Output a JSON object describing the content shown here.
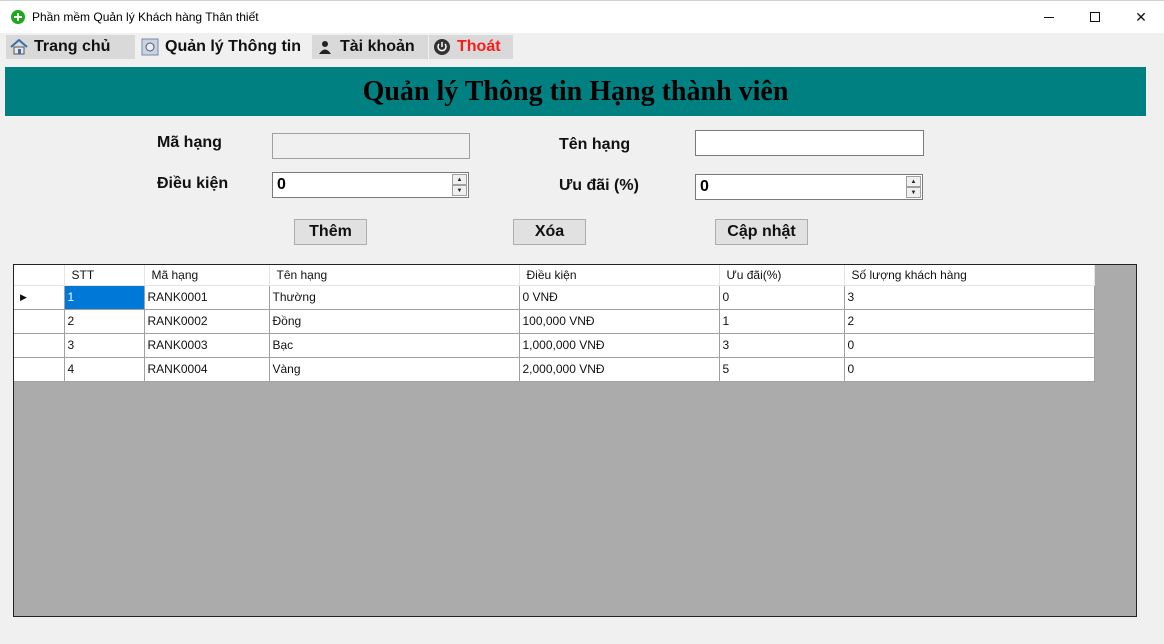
{
  "window": {
    "title": "Phần mềm Quản lý Khách hàng Thân thiết"
  },
  "menu": {
    "home": "Trang chủ",
    "info": "Quản lý Thông tin",
    "account": "Tài khoản",
    "exit": "Thoát"
  },
  "page": {
    "title": "Quản lý Thông tin Hạng thành viên"
  },
  "form": {
    "code_label": "Mã hạng",
    "code_value": "",
    "name_label": "Tên hạng",
    "name_value": "",
    "condition_label": "Điều kiện",
    "condition_value": "0",
    "discount_label": "Ưu đãi (%)",
    "discount_value": "0"
  },
  "buttons": {
    "add": "Thêm",
    "delete": "Xóa",
    "update": "Cập nhật"
  },
  "grid": {
    "columns": [
      "STT",
      "Mã hạng",
      "Tên hạng",
      "Điều kiện",
      "Ưu đãi(%)",
      "Số lượng khách hàng"
    ],
    "rows": [
      [
        "1",
        "RANK0001",
        "Thường",
        "0 VNĐ",
        "0",
        "3"
      ],
      [
        "2",
        "RANK0002",
        "Đồng",
        "100,000 VNĐ",
        "1",
        "2"
      ],
      [
        "3",
        "RANK0003",
        "Bạc",
        "1,000,000 VNĐ",
        "3",
        "0"
      ],
      [
        "4",
        "RANK0004",
        "Vàng",
        "2,000,000 VNĐ",
        "5",
        "0"
      ]
    ],
    "selected_row": 0
  },
  "colors": {
    "header_band": "#008080",
    "exit_text": "#ff1a1a",
    "selection": "#0078d7"
  }
}
